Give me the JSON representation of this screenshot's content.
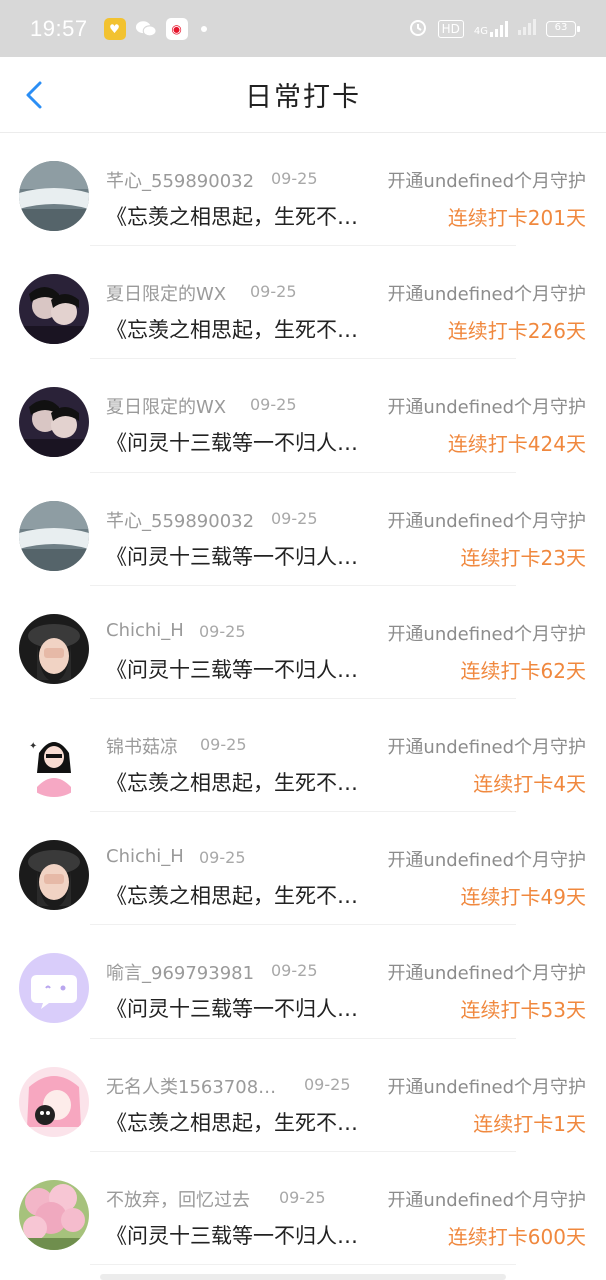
{
  "status_bar": {
    "time": "19:57",
    "network": "4G",
    "hd": "HD",
    "battery": "63"
  },
  "nav": {
    "title": "日常打卡",
    "back_icon": "chevron-left-icon"
  },
  "colors": {
    "accent": "#2b8ef5",
    "streak": "#f0883e",
    "status_bar_bg": "#d8d8d8"
  },
  "items": [
    {
      "username": "芊心_559890032",
      "date": "09-25",
      "guard": "开通undefined个月守护",
      "content": "《忘羡之相思起，生死不…",
      "streak": "连续打卡201天",
      "avatar": "waterfall-avatar"
    },
    {
      "username": "夏日限定的WX",
      "date": "09-25",
      "guard": "开通undefined个月守护",
      "content": "《忘羡之相思起，生死不…",
      "streak": "连续打卡226天",
      "avatar": "couple-avatar"
    },
    {
      "username": "夏日限定的WX",
      "date": "09-25",
      "guard": "开通undefined个月守护",
      "content": "《问灵十三载等一不归人…",
      "streak": "连续打卡424天",
      "avatar": "couple-avatar"
    },
    {
      "username": "芊心_559890032",
      "date": "09-25",
      "guard": "开通undefined个月守护",
      "content": "《问灵十三载等一不归人…",
      "streak": "连续打卡23天",
      "avatar": "waterfall-avatar"
    },
    {
      "username": "Chichi_H",
      "date": "09-25",
      "guard": "开通undefined个月守护",
      "content": "《问灵十三载等一不归人…",
      "streak": "连续打卡62天",
      "avatar": "girl-hat-avatar"
    },
    {
      "username": "锦书菇凉",
      "date": "09-25",
      "guard": "开通undefined个月守护",
      "content": "《忘羡之相思起，生死不…",
      "streak": "连续打卡4天",
      "avatar": "cartoon-girl-avatar"
    },
    {
      "username": "Chichi_H",
      "date": "09-25",
      "guard": "开通undefined个月守护",
      "content": "《忘羡之相思起，生死不…",
      "streak": "连续打卡49天",
      "avatar": "girl-hat-avatar"
    },
    {
      "username": "喻言_969793981",
      "date": "09-25",
      "guard": "开通undefined个月守护",
      "content": "《问灵十三载等一不归人…",
      "streak": "连续打卡53天",
      "avatar": "chat-bubble-avatar"
    },
    {
      "username": "无名人类1563708…",
      "date": "09-25",
      "guard": "开通undefined个月守护",
      "content": "《忘羡之相思起，生死不…",
      "streak": "连续打卡1天",
      "avatar": "anime-pink-avatar"
    },
    {
      "username": "不放弃，回忆过去",
      "date": "09-25",
      "guard": "开通undefined个月守护",
      "content": "《问灵十三载等一不归人…",
      "streak": "连续打卡600天",
      "avatar": "cherry-blossom-avatar"
    }
  ]
}
